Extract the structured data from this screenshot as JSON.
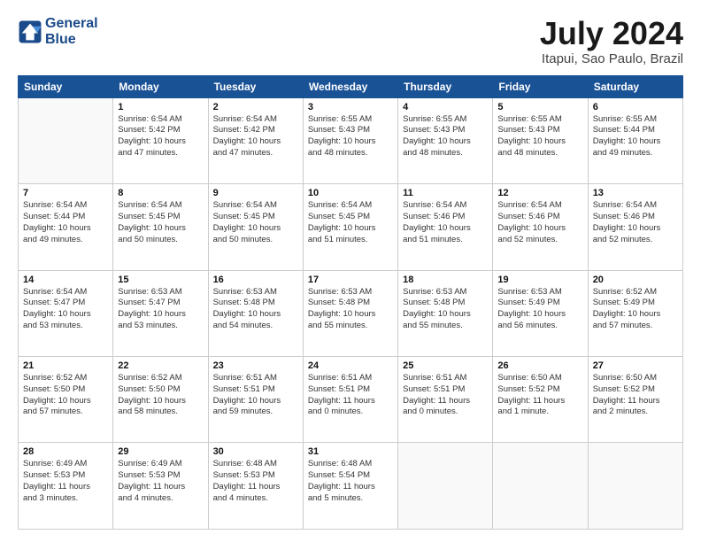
{
  "logo": {
    "line1": "General",
    "line2": "Blue"
  },
  "title": "July 2024",
  "subtitle": "Itapui, Sao Paulo, Brazil",
  "days_of_week": [
    "Sunday",
    "Monday",
    "Tuesday",
    "Wednesday",
    "Thursday",
    "Friday",
    "Saturday"
  ],
  "weeks": [
    [
      {
        "num": "",
        "info": ""
      },
      {
        "num": "1",
        "info": "Sunrise: 6:54 AM\nSunset: 5:42 PM\nDaylight: 10 hours\nand 47 minutes."
      },
      {
        "num": "2",
        "info": "Sunrise: 6:54 AM\nSunset: 5:42 PM\nDaylight: 10 hours\nand 47 minutes."
      },
      {
        "num": "3",
        "info": "Sunrise: 6:55 AM\nSunset: 5:43 PM\nDaylight: 10 hours\nand 48 minutes."
      },
      {
        "num": "4",
        "info": "Sunrise: 6:55 AM\nSunset: 5:43 PM\nDaylight: 10 hours\nand 48 minutes."
      },
      {
        "num": "5",
        "info": "Sunrise: 6:55 AM\nSunset: 5:43 PM\nDaylight: 10 hours\nand 48 minutes."
      },
      {
        "num": "6",
        "info": "Sunrise: 6:55 AM\nSunset: 5:44 PM\nDaylight: 10 hours\nand 49 minutes."
      }
    ],
    [
      {
        "num": "7",
        "info": "Sunrise: 6:54 AM\nSunset: 5:44 PM\nDaylight: 10 hours\nand 49 minutes."
      },
      {
        "num": "8",
        "info": "Sunrise: 6:54 AM\nSunset: 5:45 PM\nDaylight: 10 hours\nand 50 minutes."
      },
      {
        "num": "9",
        "info": "Sunrise: 6:54 AM\nSunset: 5:45 PM\nDaylight: 10 hours\nand 50 minutes."
      },
      {
        "num": "10",
        "info": "Sunrise: 6:54 AM\nSunset: 5:45 PM\nDaylight: 10 hours\nand 51 minutes."
      },
      {
        "num": "11",
        "info": "Sunrise: 6:54 AM\nSunset: 5:46 PM\nDaylight: 10 hours\nand 51 minutes."
      },
      {
        "num": "12",
        "info": "Sunrise: 6:54 AM\nSunset: 5:46 PM\nDaylight: 10 hours\nand 52 minutes."
      },
      {
        "num": "13",
        "info": "Sunrise: 6:54 AM\nSunset: 5:46 PM\nDaylight: 10 hours\nand 52 minutes."
      }
    ],
    [
      {
        "num": "14",
        "info": "Sunrise: 6:54 AM\nSunset: 5:47 PM\nDaylight: 10 hours\nand 53 minutes."
      },
      {
        "num": "15",
        "info": "Sunrise: 6:53 AM\nSunset: 5:47 PM\nDaylight: 10 hours\nand 53 minutes."
      },
      {
        "num": "16",
        "info": "Sunrise: 6:53 AM\nSunset: 5:48 PM\nDaylight: 10 hours\nand 54 minutes."
      },
      {
        "num": "17",
        "info": "Sunrise: 6:53 AM\nSunset: 5:48 PM\nDaylight: 10 hours\nand 55 minutes."
      },
      {
        "num": "18",
        "info": "Sunrise: 6:53 AM\nSunset: 5:48 PM\nDaylight: 10 hours\nand 55 minutes."
      },
      {
        "num": "19",
        "info": "Sunrise: 6:53 AM\nSunset: 5:49 PM\nDaylight: 10 hours\nand 56 minutes."
      },
      {
        "num": "20",
        "info": "Sunrise: 6:52 AM\nSunset: 5:49 PM\nDaylight: 10 hours\nand 57 minutes."
      }
    ],
    [
      {
        "num": "21",
        "info": "Sunrise: 6:52 AM\nSunset: 5:50 PM\nDaylight: 10 hours\nand 57 minutes."
      },
      {
        "num": "22",
        "info": "Sunrise: 6:52 AM\nSunset: 5:50 PM\nDaylight: 10 hours\nand 58 minutes."
      },
      {
        "num": "23",
        "info": "Sunrise: 6:51 AM\nSunset: 5:51 PM\nDaylight: 10 hours\nand 59 minutes."
      },
      {
        "num": "24",
        "info": "Sunrise: 6:51 AM\nSunset: 5:51 PM\nDaylight: 11 hours\nand 0 minutes."
      },
      {
        "num": "25",
        "info": "Sunrise: 6:51 AM\nSunset: 5:51 PM\nDaylight: 11 hours\nand 0 minutes."
      },
      {
        "num": "26",
        "info": "Sunrise: 6:50 AM\nSunset: 5:52 PM\nDaylight: 11 hours\nand 1 minute."
      },
      {
        "num": "27",
        "info": "Sunrise: 6:50 AM\nSunset: 5:52 PM\nDaylight: 11 hours\nand 2 minutes."
      }
    ],
    [
      {
        "num": "28",
        "info": "Sunrise: 6:49 AM\nSunset: 5:53 PM\nDaylight: 11 hours\nand 3 minutes."
      },
      {
        "num": "29",
        "info": "Sunrise: 6:49 AM\nSunset: 5:53 PM\nDaylight: 11 hours\nand 4 minutes."
      },
      {
        "num": "30",
        "info": "Sunrise: 6:48 AM\nSunset: 5:53 PM\nDaylight: 11 hours\nand 4 minutes."
      },
      {
        "num": "31",
        "info": "Sunrise: 6:48 AM\nSunset: 5:54 PM\nDaylight: 11 hours\nand 5 minutes."
      },
      {
        "num": "",
        "info": ""
      },
      {
        "num": "",
        "info": ""
      },
      {
        "num": "",
        "info": ""
      }
    ]
  ]
}
